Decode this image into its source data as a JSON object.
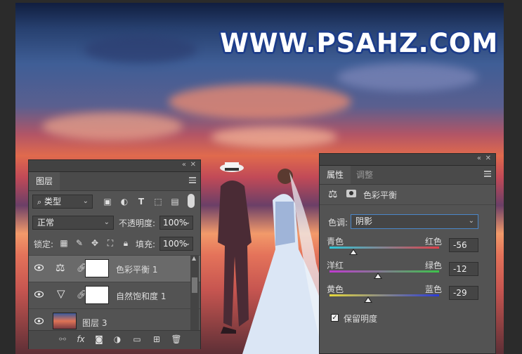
{
  "watermark": "WWW.PSAHZ.COM",
  "layers_panel": {
    "tab_label": "图层",
    "filter_kind": "类型",
    "blend_mode": "正常",
    "opacity_label": "不透明度:",
    "opacity_value": "100%",
    "lock_label": "锁定:",
    "fill_label": "填充:",
    "fill_value": "100%",
    "layers": [
      {
        "name": "色彩平衡 1",
        "selected": true
      },
      {
        "name": "自然饱和度 1",
        "selected": false
      },
      {
        "name": "图层 3",
        "selected": false
      }
    ]
  },
  "properties_panel": {
    "tabs": [
      "属性",
      "调整"
    ],
    "adjustment_title": "色彩平衡",
    "tone_label": "色调:",
    "tone_value": "阴影",
    "sliders": [
      {
        "left": "青色",
        "right": "红色",
        "value": "-56",
        "level": -56
      },
      {
        "left": "洋红",
        "right": "绿色",
        "value": "-12",
        "level": -12
      },
      {
        "left": "黄色",
        "right": "蓝色",
        "value": "-29",
        "level": -29
      }
    ],
    "preserve_luminosity_label": "保留明度",
    "preserve_luminosity_checked": true
  },
  "colors": {
    "panel_bg": "#535353",
    "panel_header": "#424242",
    "selected_layer": "#6a6a6a",
    "watermark_outline": "#1d3d8a"
  }
}
